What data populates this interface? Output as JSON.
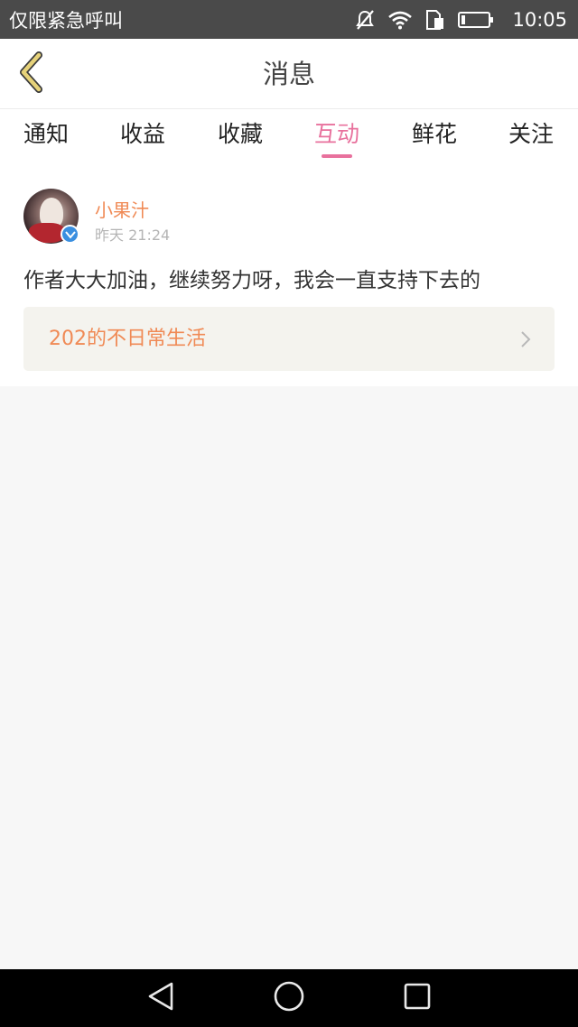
{
  "status_bar": {
    "carrier": "仅限紧急呼叫",
    "time": "10:05",
    "icons": [
      "mute-icon",
      "wifi-icon",
      "sim-icon",
      "battery-icon"
    ]
  },
  "header": {
    "title": "消息",
    "back_icon": "chevron-left-icon"
  },
  "tabs": [
    {
      "label": "通知",
      "active": false
    },
    {
      "label": "收益",
      "active": false
    },
    {
      "label": "收藏",
      "active": false
    },
    {
      "label": "互动",
      "active": true
    },
    {
      "label": "鲜花",
      "active": false
    },
    {
      "label": "关注",
      "active": false
    }
  ],
  "post": {
    "user_name": "小果汁",
    "time": "昨天 21:24",
    "verified": true,
    "comment": "作者大大加油，继续努力呀，我会一直支持下去的",
    "work_title": "202的不日常生活"
  },
  "nav_bar": {
    "icons": [
      "back-triangle-icon",
      "home-circle-icon",
      "recents-square-icon"
    ]
  },
  "colors": {
    "accent": "#e8719d",
    "name_orange": "#f08a55",
    "background": "#f7f7f7",
    "status_bar": "#4a4a4a",
    "back_arrow": "#e6d27a"
  }
}
